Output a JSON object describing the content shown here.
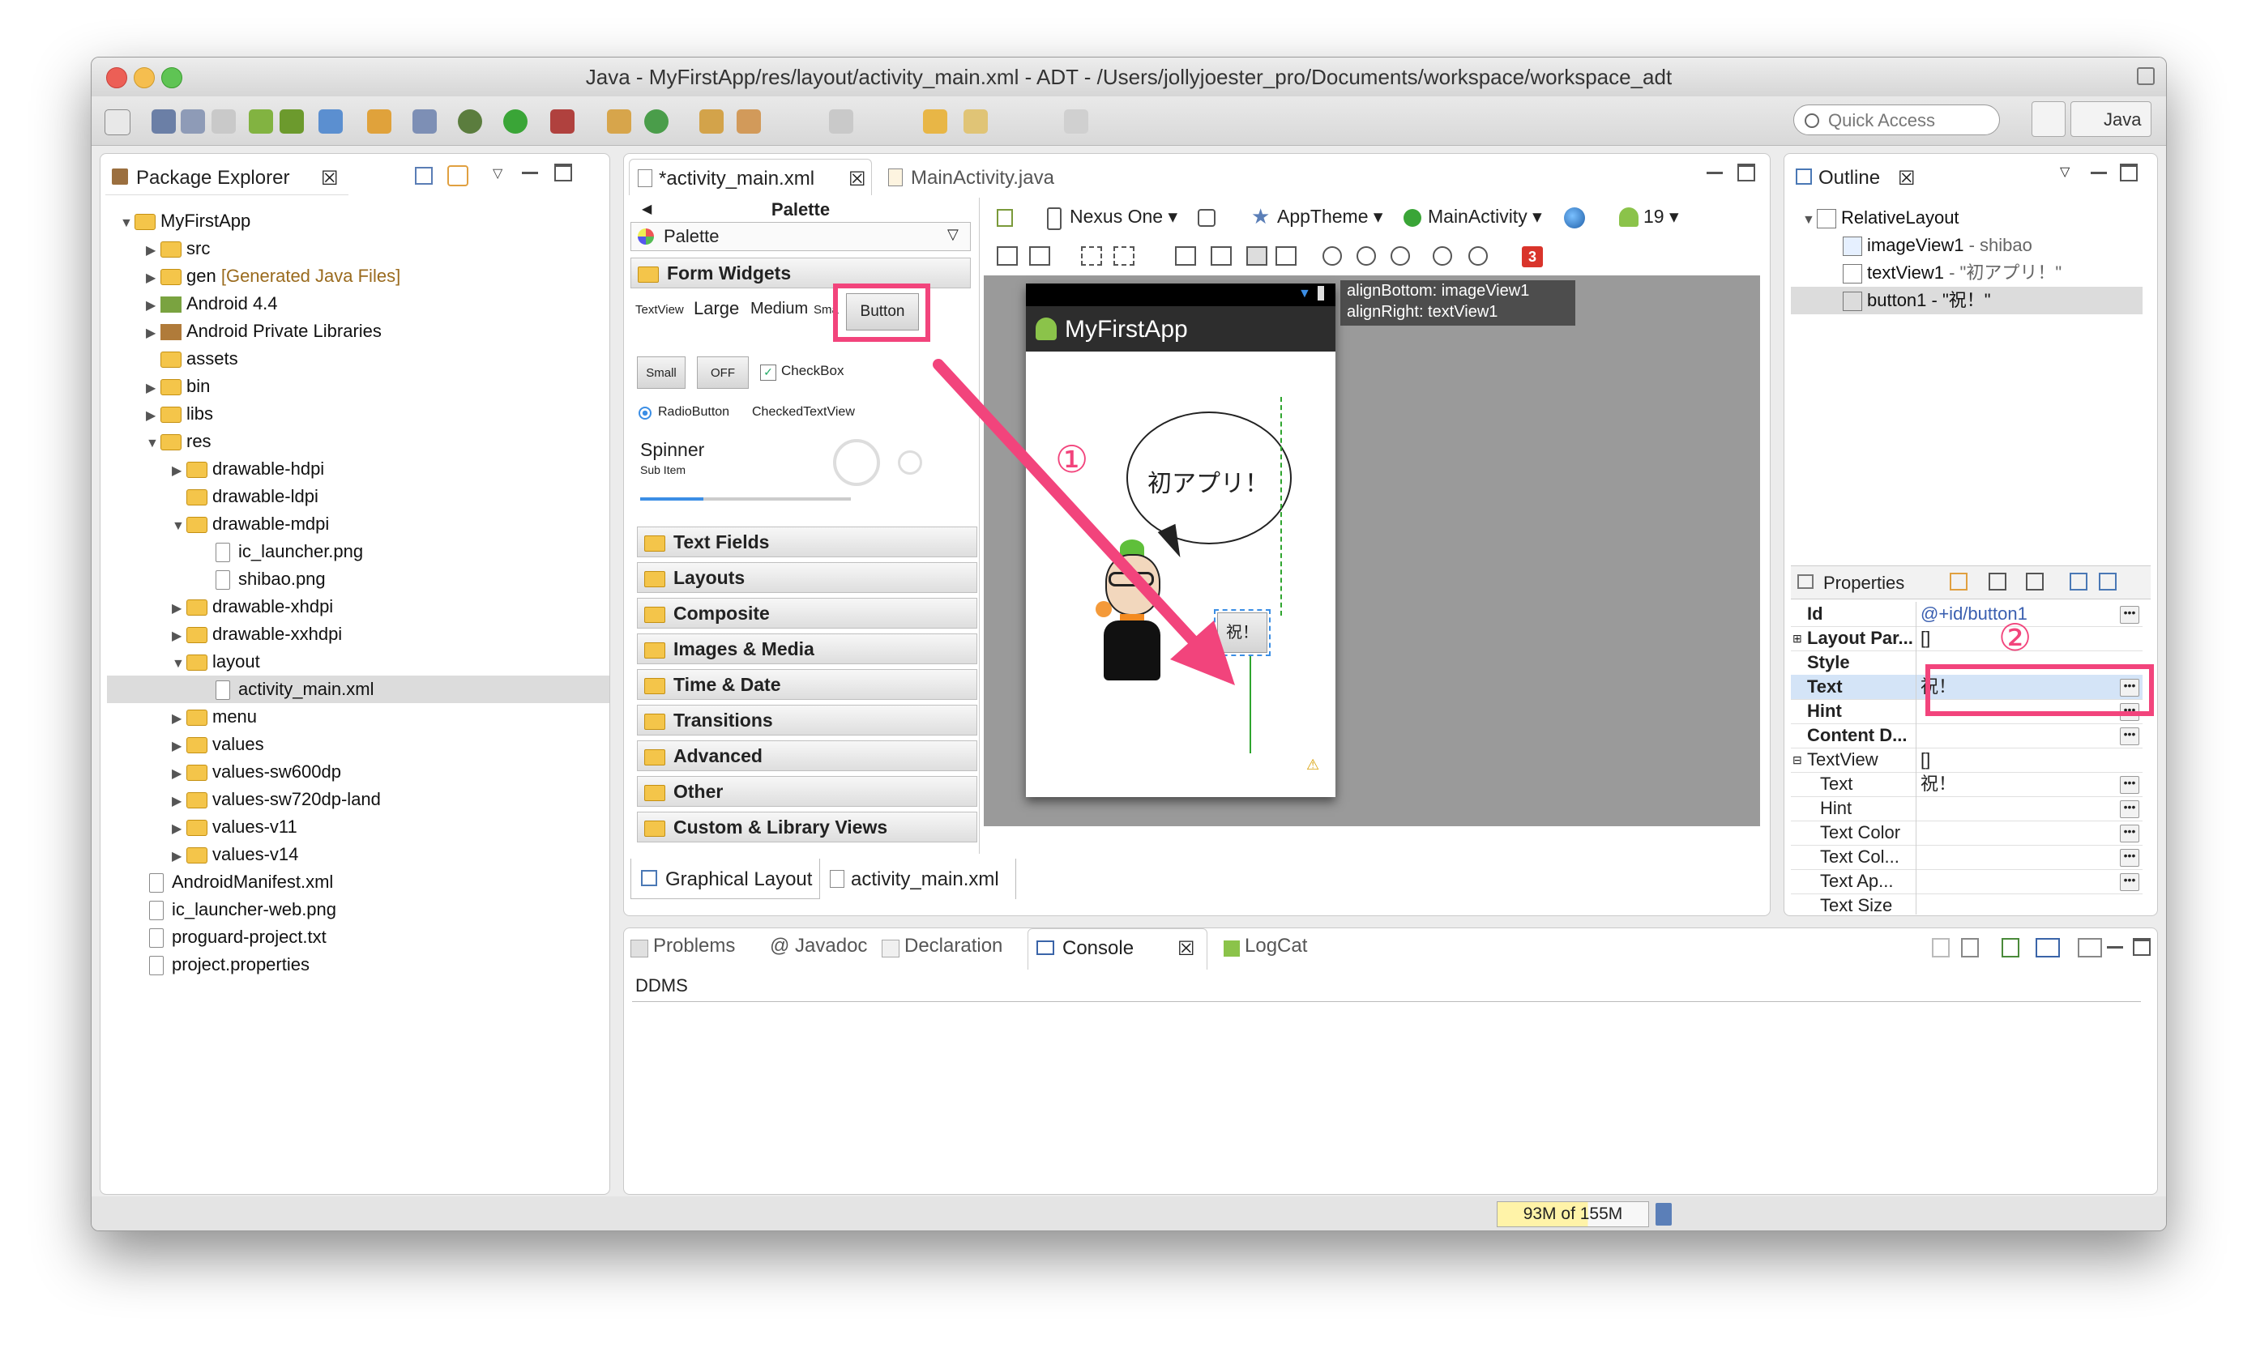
{
  "window": {
    "title": "Java - MyFirstApp/res/layout/activity_main.xml - ADT - /Users/jollyjoester_pro/Documents/workspace/workspace_adt"
  },
  "toolbar": {
    "quick_access_placeholder": "Quick Access",
    "perspective_label": "Java"
  },
  "package_explorer": {
    "tab_label": "Package Explorer",
    "items": [
      {
        "label": "MyFirstApp",
        "suffix": ""
      },
      {
        "label": "src",
        "suffix": ""
      },
      {
        "label": "gen",
        "suffix": "[Generated Java Files]"
      },
      {
        "label": "Android 4.4",
        "suffix": ""
      },
      {
        "label": "Android Private Libraries",
        "suffix": ""
      },
      {
        "label": "assets",
        "suffix": ""
      },
      {
        "label": "bin",
        "suffix": ""
      },
      {
        "label": "libs",
        "suffix": ""
      },
      {
        "label": "res",
        "suffix": ""
      },
      {
        "label": "drawable-hdpi",
        "suffix": ""
      },
      {
        "label": "drawable-ldpi",
        "suffix": ""
      },
      {
        "label": "drawable-mdpi",
        "suffix": ""
      },
      {
        "label": "ic_launcher.png",
        "suffix": ""
      },
      {
        "label": "shibao.png",
        "suffix": ""
      },
      {
        "label": "drawable-xhdpi",
        "suffix": ""
      },
      {
        "label": "drawable-xxhdpi",
        "suffix": ""
      },
      {
        "label": "layout",
        "suffix": ""
      },
      {
        "label": "activity_main.xml",
        "suffix": ""
      },
      {
        "label": "menu",
        "suffix": ""
      },
      {
        "label": "values",
        "suffix": ""
      },
      {
        "label": "values-sw600dp",
        "suffix": ""
      },
      {
        "label": "values-sw720dp-land",
        "suffix": ""
      },
      {
        "label": "values-v11",
        "suffix": ""
      },
      {
        "label": "values-v14",
        "suffix": ""
      },
      {
        "label": "AndroidManifest.xml",
        "suffix": ""
      },
      {
        "label": "ic_launcher-web.png",
        "suffix": ""
      },
      {
        "label": "proguard-project.txt",
        "suffix": ""
      },
      {
        "label": "project.properties",
        "suffix": ""
      }
    ]
  },
  "editor": {
    "tabs": [
      {
        "label": "*activity_main.xml"
      },
      {
        "label": "MainActivity.java"
      }
    ],
    "palette": {
      "header": "Palette",
      "selector": "Palette",
      "open_category": "Form Widgets",
      "widgets_row1": {
        "textview": "TextView",
        "large": "Large",
        "medium": "Medium",
        "small": "Sma",
        "button": "Button"
      },
      "widgets_row2": {
        "small_button": "Small",
        "toggle": "OFF",
        "checkbox": "CheckBox"
      },
      "widgets_row3": {
        "radio": "RadioButton",
        "checked": "CheckedTextView"
      },
      "spinner": {
        "title": "Spinner",
        "sub": "Sub Item"
      },
      "categories": [
        "Text Fields",
        "Layouts",
        "Composite",
        "Images & Media",
        "Time & Date",
        "Transitions",
        "Advanced",
        "Other",
        "Custom & Library Views"
      ]
    },
    "config_bar": {
      "device": "Nexus One",
      "theme": "AppTheme",
      "activity": "MainActivity",
      "api": "19"
    },
    "error_count": "3",
    "hint": {
      "line1": "alignBottom: imageView1",
      "line2": "alignRight: textView1"
    },
    "device_preview": {
      "app_title": "MyFirstApp",
      "bubble_text": "初アプリ！",
      "button_text": "祝！"
    },
    "annotations": {
      "one": "①",
      "two": "②"
    },
    "bottom_tabs": [
      {
        "label": "Graphical Layout"
      },
      {
        "label": "activity_main.xml"
      }
    ]
  },
  "outline": {
    "tab_label": "Outline",
    "root": "RelativeLayout",
    "children": [
      {
        "name": "imageView1",
        "detail": "- shibao"
      },
      {
        "name": "textView1",
        "detail": "- \"初アプリ！\""
      },
      {
        "name": "button1",
        "detail": "- \"祝！\""
      }
    ]
  },
  "properties": {
    "tab_label": "Properties",
    "rows": [
      {
        "name": "Id",
        "value": "@+id/button1"
      },
      {
        "name": "Layout Par...",
        "value": "[]"
      },
      {
        "name": "Style",
        "value": ""
      },
      {
        "name": "Text",
        "value": "祝！"
      },
      {
        "name": "Hint",
        "value": ""
      },
      {
        "name": "Content D...",
        "value": ""
      },
      {
        "name": "TextView",
        "value": "[]"
      },
      {
        "name": "Text",
        "value": "祝！"
      },
      {
        "name": "Hint",
        "value": ""
      },
      {
        "name": "Text Color",
        "value": ""
      },
      {
        "name": "Text Col...",
        "value": ""
      },
      {
        "name": "Text Ap...",
        "value": ""
      },
      {
        "name": "Text Size",
        "value": ""
      }
    ]
  },
  "bottom_panel": {
    "tabs": [
      {
        "label": "Problems"
      },
      {
        "label": "Javadoc"
      },
      {
        "label": "Declaration"
      },
      {
        "label": "Console"
      },
      {
        "label": "LogCat"
      }
    ],
    "console_text": "DDMS"
  },
  "status": {
    "memory": "93M of 155M"
  },
  "colors": {
    "highlight": "#f2447c",
    "selection": "#d4e4f7",
    "android_bar": "#2d2d2d"
  }
}
